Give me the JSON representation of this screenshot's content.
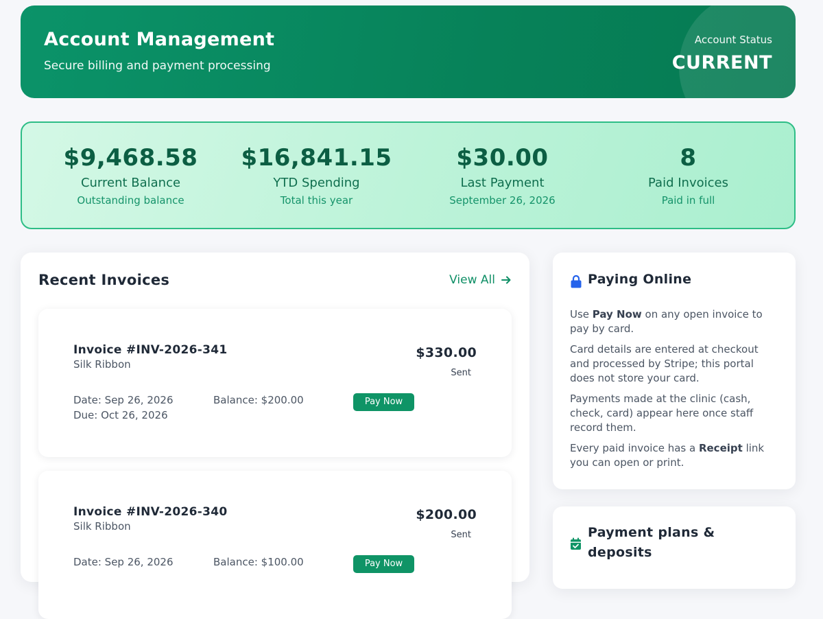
{
  "header": {
    "title": "Account Management",
    "subtitle": "Secure billing and payment processing",
    "status_label": "Account Status",
    "status_value": "CURRENT"
  },
  "stats": [
    {
      "value": "$9,468.58",
      "label": "Current Balance",
      "sub": "Outstanding balance"
    },
    {
      "value": "$16,841.15",
      "label": "YTD Spending",
      "sub": "Total this year"
    },
    {
      "value": "$30.00",
      "label": "Last Payment",
      "sub": "September 26, 2026"
    },
    {
      "value": "8",
      "label": "Paid Invoices",
      "sub": "Paid in full"
    }
  ],
  "invoices": {
    "title": "Recent Invoices",
    "view_all": "View All",
    "items": [
      {
        "number": "Invoice #INV-2026-341",
        "client": "Silk Ribbon",
        "amount": "$330.00",
        "status": "Sent",
        "date": "Date: Sep 26, 2026",
        "due": "Due: Oct 26, 2026",
        "balance": "Balance: $200.00",
        "action": "Pay Now"
      },
      {
        "number": "Invoice #INV-2026-340",
        "client": "Silk Ribbon",
        "amount": "$200.00",
        "status": "Sent",
        "date": "Date: Sep 26, 2026",
        "due": "",
        "balance": "Balance: $100.00",
        "action": "Pay Now"
      }
    ]
  },
  "paying_online": {
    "title": "Paying Online",
    "p1_pre": "Use ",
    "p1_bold": "Pay Now",
    "p1_post": " on any open invoice to pay by card.",
    "p2": "Card details are entered at checkout and processed by Stripe; this portal does not store your card.",
    "p3": "Payments made at the clinic (cash, check, card) appear here once staff record them.",
    "p4_pre": "Every paid invoice has a ",
    "p4_bold": "Receipt",
    "p4_post": " link you can open or print."
  },
  "payment_plans": {
    "title": "Payment plans & deposits"
  },
  "colors": {
    "brand_green": "#078259",
    "accent_green": "#0f9466",
    "lock_icon": "#2563eb"
  }
}
